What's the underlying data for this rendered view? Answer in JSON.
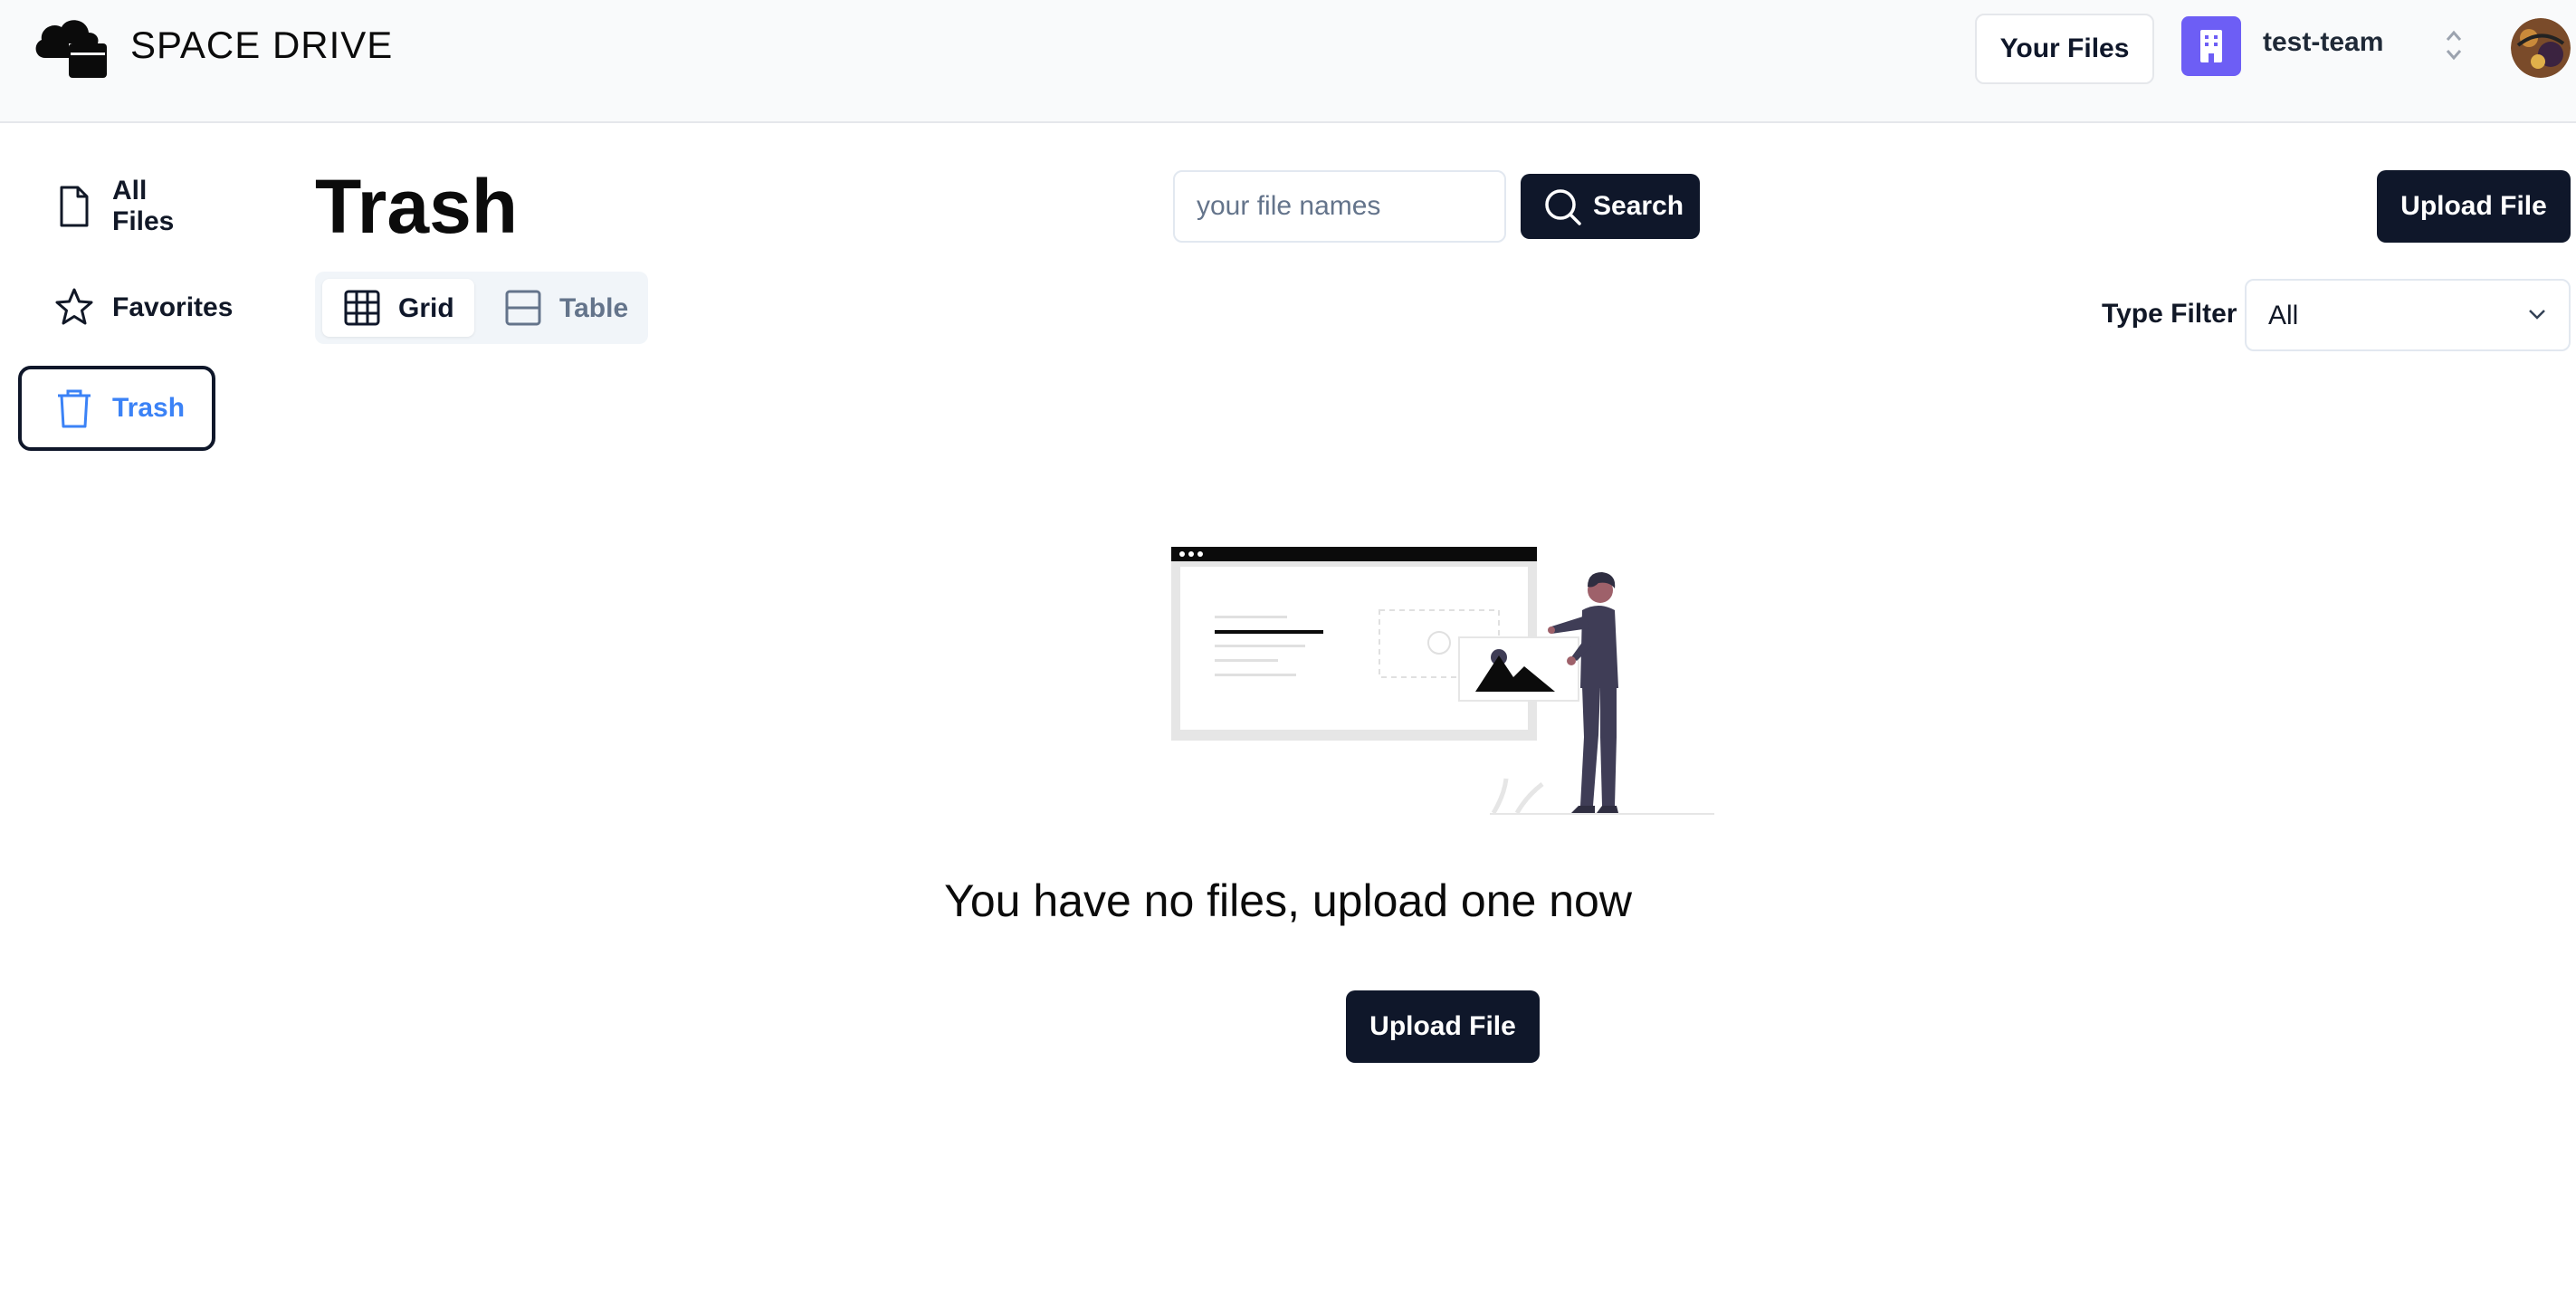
{
  "header": {
    "app_title": "SPACE DRIVE",
    "logo_icon": "cloud-folder-icon",
    "your_files_label": "Your Files",
    "team": {
      "name": "test-team",
      "icon": "building-icon",
      "icon_bg": "#6d5ef5"
    },
    "user_avatar": "avatar-image"
  },
  "sidebar": {
    "items": [
      {
        "label": "All Files",
        "icon": "file-icon",
        "active": false
      },
      {
        "label": "Favorites",
        "icon": "star-icon",
        "active": false
      },
      {
        "label": "Trash",
        "icon": "trash-icon",
        "active": true
      }
    ]
  },
  "main": {
    "title": "Trash",
    "search": {
      "placeholder": "your file names",
      "value": "",
      "button_label": "Search"
    },
    "upload_label": "Upload File",
    "view_toggle": {
      "options": [
        "Grid",
        "Table"
      ],
      "selected": "Grid"
    },
    "type_filter": {
      "label": "Type Filter",
      "value": "All"
    },
    "empty_state": {
      "message": "You have no files, upload one now",
      "button_label": "Upload File"
    }
  },
  "colors": {
    "primary": "#0f172a",
    "accent": "#3b82f6",
    "header_bg": "#f9fafb",
    "team_icon_bg": "#6d5ef5"
  }
}
